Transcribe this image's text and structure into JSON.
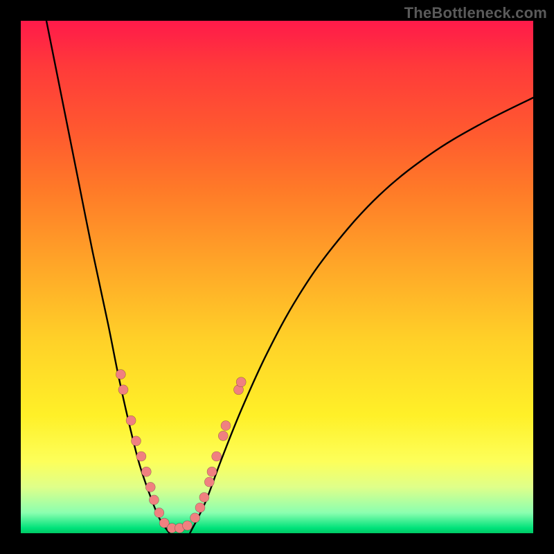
{
  "watermark": "TheBottleneck.com",
  "colors": {
    "background_frame": "#000000",
    "gradient_top": "#ff1a4a",
    "gradient_bottom": "#00c864",
    "curve": "#000000",
    "dots": "#f08080"
  },
  "chart_data": {
    "type": "line",
    "title": "",
    "xlabel": "",
    "ylabel": "",
    "xlim": [
      0,
      100
    ],
    "ylim": [
      0,
      100
    ],
    "notes": "Two downward-sloping curves meeting near x≈27–33 forming a V; minimum at y≈0. No axis ticks or labels visible.",
    "series": [
      {
        "name": "left-curve",
        "x": [
          5,
          8,
          11,
          14,
          17,
          19,
          21,
          23,
          25,
          27,
          29
        ],
        "y": [
          100,
          85,
          70,
          55,
          41,
          31,
          22,
          14,
          8,
          3,
          0
        ]
      },
      {
        "name": "right-curve",
        "x": [
          33,
          36,
          39,
          43,
          48,
          54,
          61,
          70,
          80,
          90,
          100
        ],
        "y": [
          0,
          6,
          14,
          24,
          35,
          46,
          56,
          66,
          74,
          80,
          85
        ]
      }
    ],
    "dots": [
      {
        "x": 19.5,
        "y": 31
      },
      {
        "x": 20.0,
        "y": 28
      },
      {
        "x": 21.5,
        "y": 22
      },
      {
        "x": 22.5,
        "y": 18
      },
      {
        "x": 23.5,
        "y": 15
      },
      {
        "x": 24.5,
        "y": 12
      },
      {
        "x": 25.3,
        "y": 9
      },
      {
        "x": 26.0,
        "y": 6.5
      },
      {
        "x": 27.0,
        "y": 4
      },
      {
        "x": 28.0,
        "y": 2
      },
      {
        "x": 29.5,
        "y": 1
      },
      {
        "x": 31.0,
        "y": 1
      },
      {
        "x": 32.5,
        "y": 1.5
      },
      {
        "x": 34.0,
        "y": 3
      },
      {
        "x": 35.0,
        "y": 5
      },
      {
        "x": 35.8,
        "y": 7
      },
      {
        "x": 36.8,
        "y": 10
      },
      {
        "x": 37.3,
        "y": 12
      },
      {
        "x": 38.2,
        "y": 15
      },
      {
        "x": 39.5,
        "y": 19
      },
      {
        "x": 40.0,
        "y": 21
      },
      {
        "x": 42.5,
        "y": 28
      },
      {
        "x": 43.0,
        "y": 29.5
      }
    ]
  }
}
